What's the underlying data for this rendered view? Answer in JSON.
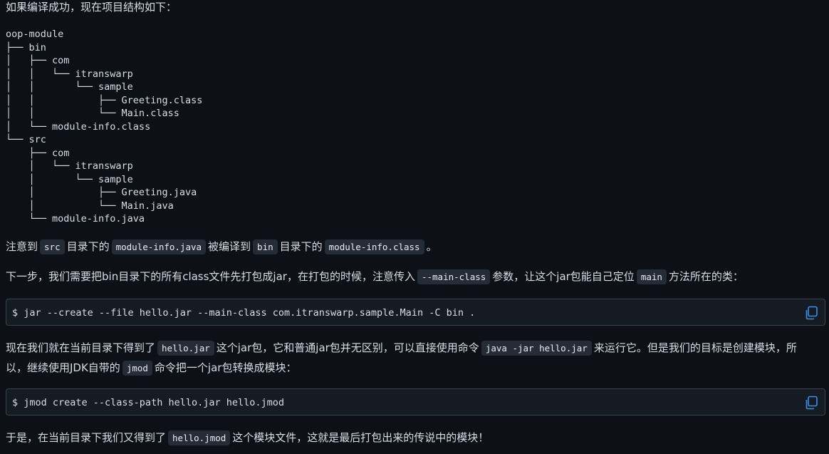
{
  "intro": "如果编译成功，现在项目结构如下：",
  "tree": [
    "oop-module",
    "├── bin",
    "│   ├── com",
    "│   │   └── itranswarp",
    "│   │       └── sample",
    "│   │           ├── Greeting.class",
    "│   │           └── Main.class",
    "│   └── module-info.class",
    "└── src",
    "    ├── com",
    "    │   └── itranswarp",
    "    │       └── sample",
    "    │           ├── Greeting.java",
    "    │           └── Main.java",
    "    └── module-info.java"
  ],
  "note": {
    "t1": "注意到",
    "c1": "src",
    "t2": "目录下的",
    "c2": "module-info.java",
    "t3": "被编译到",
    "c3": "bin",
    "t4": "目录下的",
    "c4": "module-info.class",
    "t5": "。"
  },
  "step": {
    "t1": "下一步，我们需要把bin目录下的所有class文件先打包成jar，在打包的时候，注意传入",
    "c1": "--main-class",
    "t2": "参数，让这个jar包能自己定位",
    "c2": "main",
    "t3": "方法所在的类："
  },
  "cmd1": "$ jar --create --file hello.jar --main-class com.itranswarp.sample.Main -C bin .",
  "got": {
    "t1": "现在我们就在当前目录下得到了",
    "c1": "hello.jar",
    "t2": "这个jar包，它和普通jar包并无区别，可以直接使用命令",
    "c2": "java -jar hello.jar",
    "t3": "来运行它。但是我们的目标是创建模块，所",
    "t4": "以，继续使用JDK自带的",
    "c3": "jmod",
    "t5": "命令把一个jar包转换成模块："
  },
  "cmd2": "$ jmod create --class-path hello.jar hello.jmod",
  "final": {
    "t1": "于是，在当前目录下我们又得到了",
    "c1": "hello.jmod",
    "t2": "这个模块文件，这就是最后打包出来的传说中的模块！"
  },
  "icons": {
    "copy": "copy-icon"
  },
  "colors": {
    "background": "#0d1117",
    "text": "#d8dee6",
    "inline_code_bg": "#262c36",
    "block_bg": "#151b23",
    "block_border": "#3a424d",
    "icon": "#3b8eea"
  }
}
